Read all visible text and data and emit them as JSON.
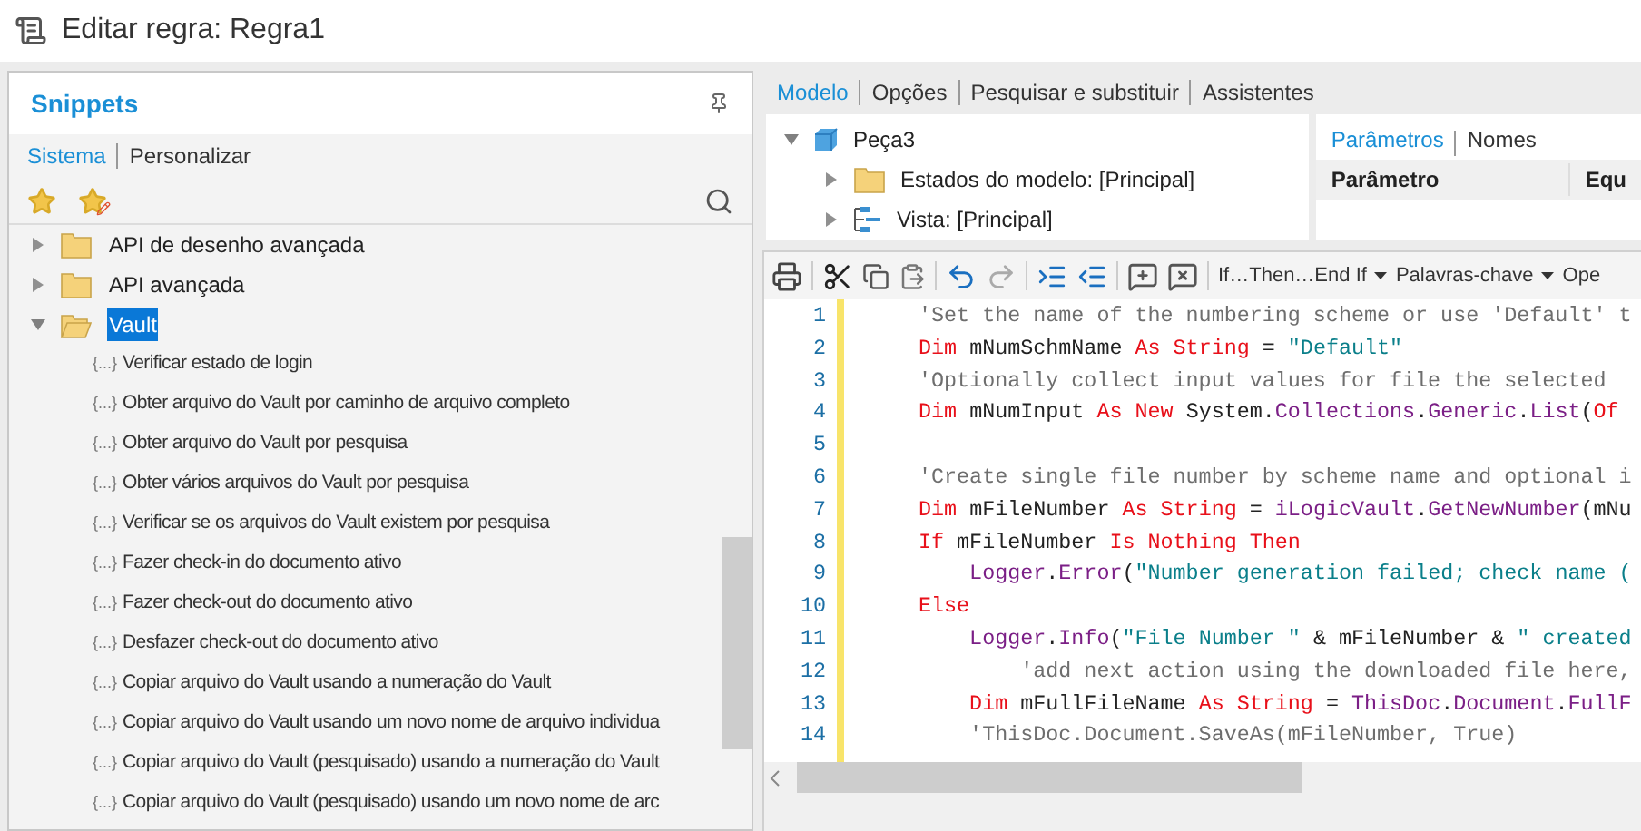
{
  "window": {
    "title": "Editar regra: Regra1"
  },
  "snippets": {
    "title": "Snippets",
    "tabs": [
      {
        "label": "Sistema",
        "selected": true
      },
      {
        "label": "Personalizar",
        "selected": false
      }
    ],
    "tree": [
      {
        "label": "API de desenho avançada",
        "expanded": false,
        "selected": false
      },
      {
        "label": "API avançada",
        "expanded": false,
        "selected": false
      },
      {
        "label": "Vault",
        "expanded": true,
        "selected": true,
        "children": [
          {
            "marker": "{...}",
            "label": "Verificar estado de login"
          },
          {
            "marker": "{...}",
            "label": "Obter arquivo do Vault por caminho de arquivo completo"
          },
          {
            "marker": "{...}",
            "label": "Obter arquivo do Vault por pesquisa"
          },
          {
            "marker": "{...}",
            "label": "Obter vários arquivos do Vault por pesquisa"
          },
          {
            "marker": "{...}",
            "label": "Verificar se os arquivos do Vault existem por pesquisa"
          },
          {
            "marker": "{...}",
            "label": "Fazer check-in do documento ativo"
          },
          {
            "marker": "{...}",
            "label": "Fazer check-out do documento ativo"
          },
          {
            "marker": "{...}",
            "label": "Desfazer check-out do documento ativo"
          },
          {
            "marker": "{...}",
            "label": "Copiar arquivo do Vault usando a numeração do Vault"
          },
          {
            "marker": "{...}",
            "label": "Copiar arquivo do Vault usando um novo nome de arquivo individua"
          },
          {
            "marker": "{...}",
            "label": "Copiar arquivo do Vault (pesquisado) usando a numeração do Vault"
          },
          {
            "marker": "{...}",
            "label": "Copiar arquivo do Vault (pesquisado) usando um novo nome de arc"
          }
        ]
      }
    ]
  },
  "main_tabs": [
    {
      "label": "Modelo",
      "selected": true
    },
    {
      "label": "Opções",
      "selected": false
    },
    {
      "label": "Pesquisar e substituir",
      "selected": false
    },
    {
      "label": "Assistentes",
      "selected": false
    }
  ],
  "model_tree": [
    {
      "label": "Peça3",
      "kind": "part",
      "expanded": true,
      "children": [
        {
          "label": "Estados do modelo: [Principal]",
          "kind": "folder",
          "expanded": false
        },
        {
          "label": "Vista: [Principal]",
          "kind": "view",
          "expanded": false
        }
      ]
    }
  ],
  "params": {
    "tabs": [
      {
        "label": "Parâmetros",
        "selected": true
      },
      {
        "label": "Nomes",
        "selected": false
      }
    ],
    "columns": [
      "Parâmetro",
      "Equ"
    ]
  },
  "toolbar": {
    "dropdowns": [
      "If…Then…End If",
      "Palavras-chave",
      "Ope"
    ]
  },
  "code": [
    {
      "number": "1",
      "tokens": [
        {
          "kind": "comment",
          "text": "'Set the name of the numbering scheme or use 'Default' t"
        }
      ]
    },
    {
      "number": "2",
      "tokens": [
        {
          "kind": "keyword",
          "text": "Dim "
        },
        {
          "kind": "plain",
          "text": "mNumSchmName "
        },
        {
          "kind": "keyword",
          "text": "As String"
        },
        {
          "kind": "plain",
          "text": " = "
        },
        {
          "kind": "string",
          "text": "\"Default\""
        }
      ]
    },
    {
      "number": "3",
      "tokens": [
        {
          "kind": "comment",
          "text": "'Optionally collect input values for file the selected"
        }
      ]
    },
    {
      "number": "4",
      "tokens": [
        {
          "kind": "keyword",
          "text": "Dim "
        },
        {
          "kind": "plain",
          "text": "mNumInput "
        },
        {
          "kind": "keyword",
          "text": "As New "
        },
        {
          "kind": "plain",
          "text": "System."
        },
        {
          "kind": "member",
          "text": "Collections"
        },
        {
          "kind": "plain",
          "text": "."
        },
        {
          "kind": "member",
          "text": "Generic"
        },
        {
          "kind": "plain",
          "text": "."
        },
        {
          "kind": "member",
          "text": "List"
        },
        {
          "kind": "plain",
          "text": "("
        },
        {
          "kind": "keyword",
          "text": "Of"
        }
      ]
    },
    {
      "number": "5"
    },
    {
      "number": "6",
      "tokens": [
        {
          "kind": "comment",
          "text": "'Create single file number by scheme name and optional i"
        }
      ]
    },
    {
      "number": "7",
      "tokens": [
        {
          "kind": "keyword",
          "text": "Dim "
        },
        {
          "kind": "plain",
          "text": "mFileNumber "
        },
        {
          "kind": "keyword",
          "text": "As String"
        },
        {
          "kind": "plain",
          "text": " = "
        },
        {
          "kind": "member",
          "text": "iLogicVault"
        },
        {
          "kind": "plain",
          "text": "."
        },
        {
          "kind": "member",
          "text": "GetNewNumber"
        },
        {
          "kind": "plain",
          "text": "(mNu"
        }
      ]
    },
    {
      "number": "8",
      "tokens": [
        {
          "kind": "keyword",
          "text": "If "
        },
        {
          "kind": "plain",
          "text": "mFileNumber "
        },
        {
          "kind": "keyword",
          "text": "Is Nothing Then"
        }
      ]
    },
    {
      "number": "9",
      "tokens": [
        {
          "kind": "member",
          "text": "    Logger"
        },
        {
          "kind": "plain",
          "text": "."
        },
        {
          "kind": "member",
          "text": "Error"
        },
        {
          "kind": "plain",
          "text": "("
        },
        {
          "kind": "string",
          "text": "\"Number generation failed; check name ("
        }
      ]
    },
    {
      "number": "10",
      "tokens": [
        {
          "kind": "keyword",
          "text": "Else"
        }
      ]
    },
    {
      "number": "11",
      "tokens": [
        {
          "kind": "member",
          "text": "    Logger"
        },
        {
          "kind": "plain",
          "text": "."
        },
        {
          "kind": "member",
          "text": "Info"
        },
        {
          "kind": "plain",
          "text": "("
        },
        {
          "kind": "string",
          "text": "\"File Number \""
        },
        {
          "kind": "plain",
          "text": " & mFileNumber & "
        },
        {
          "kind": "string",
          "text": "\" created"
        }
      ]
    },
    {
      "number": "12",
      "tokens": [
        {
          "kind": "comment",
          "text": "        'add next action using the downloaded file here,"
        }
      ]
    },
    {
      "number": "13",
      "tokens": [
        {
          "kind": "keyword",
          "text": "    Dim "
        },
        {
          "kind": "plain",
          "text": "mFullFileName "
        },
        {
          "kind": "keyword",
          "text": "As String"
        },
        {
          "kind": "plain",
          "text": " = "
        },
        {
          "kind": "member",
          "text": "ThisDoc"
        },
        {
          "kind": "plain",
          "text": "."
        },
        {
          "kind": "member",
          "text": "Document"
        },
        {
          "kind": "plain",
          "text": "."
        },
        {
          "kind": "member",
          "text": "FullF"
        }
      ]
    },
    {
      "number": "14",
      "tokens": [
        {
          "kind": "comment",
          "text": "    'ThisDoc.Document.SaveAs(mFileNumber, True)"
        }
      ]
    }
  ]
}
